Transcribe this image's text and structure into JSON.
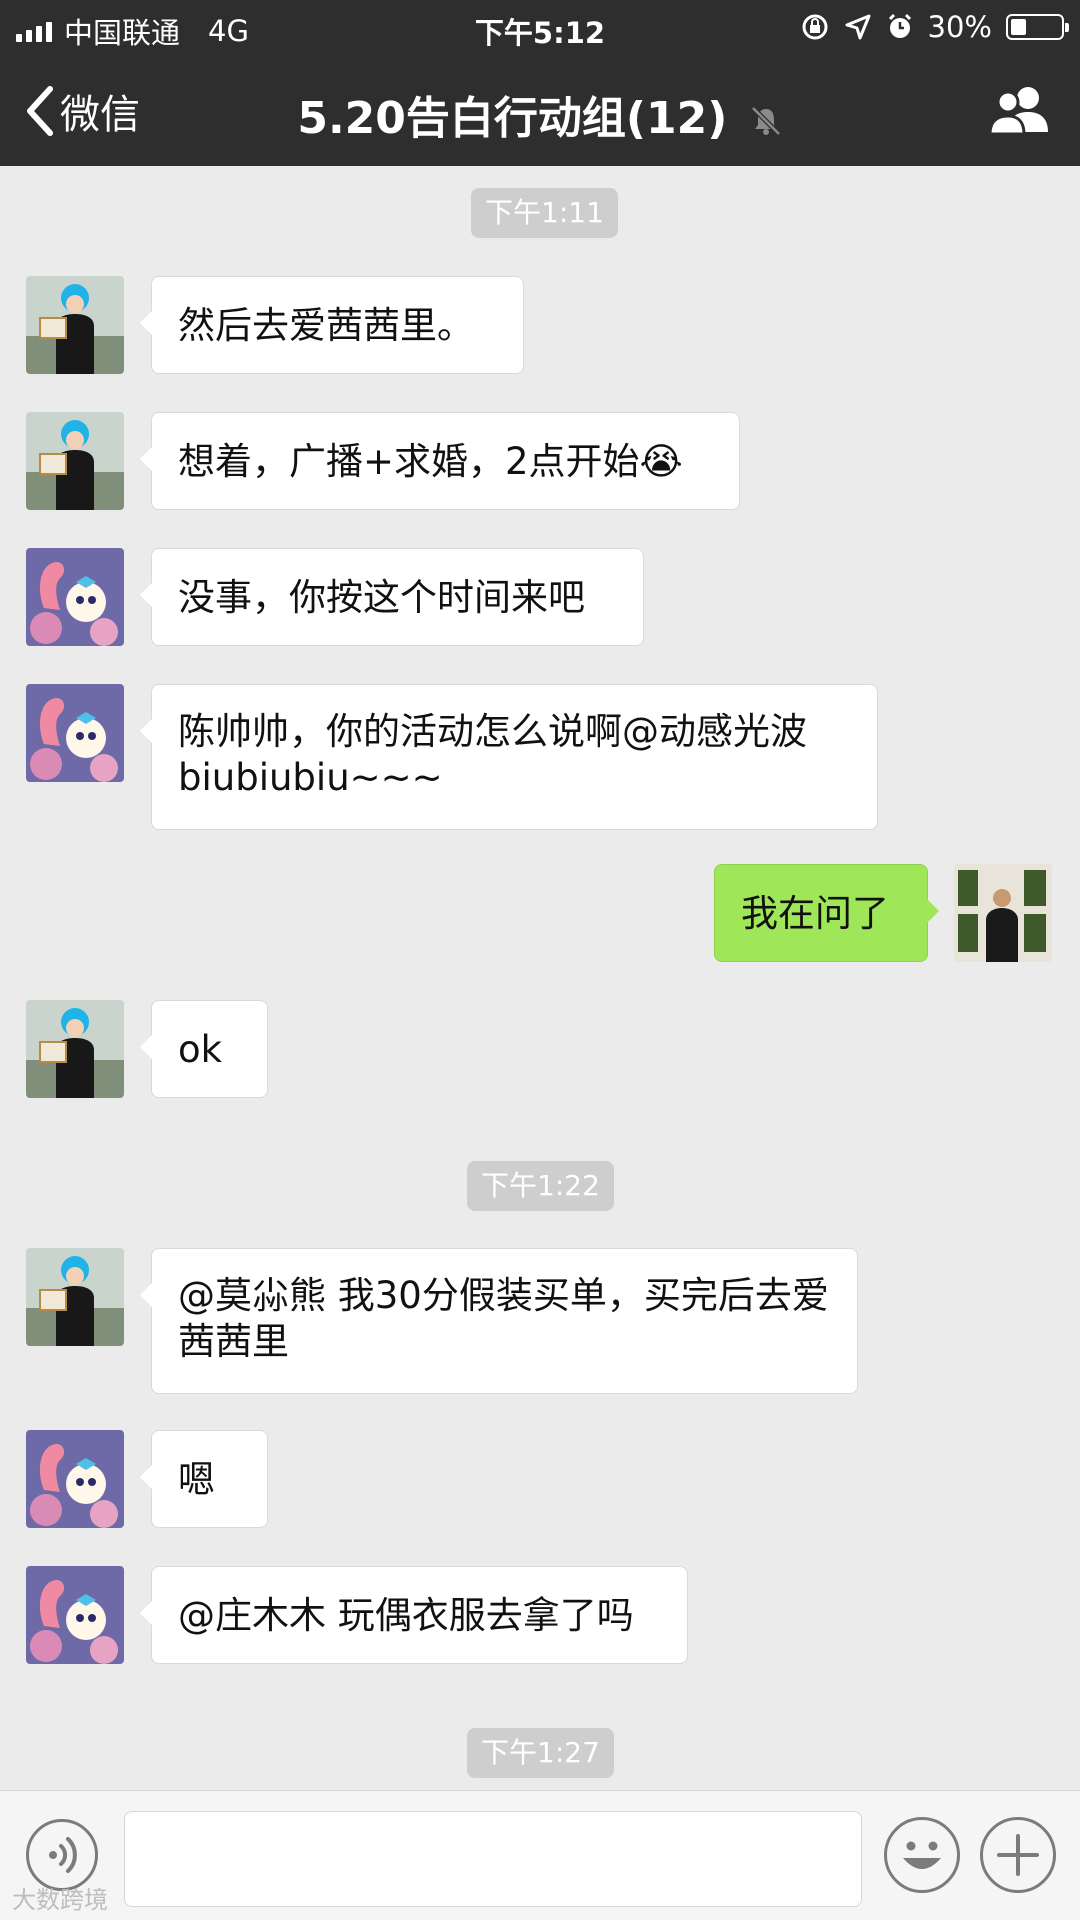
{
  "status_bar": {
    "carrier": "中国联通",
    "network": "4G",
    "time": "下午5:12",
    "battery_percent": "30%",
    "battery_level": 0.3
  },
  "nav": {
    "back_label": "微信",
    "title": "5.20告白行动组(12)"
  },
  "timestamps": [
    "下午1:11",
    "下午1:22",
    "下午1:27"
  ],
  "messages": [
    {
      "text": "然后去爱茜茜里。",
      "side": "left",
      "sender_avatar": "avatar-blue-hair"
    },
    {
      "text": "想着，广播+求婚，2点开始",
      "emoji": "😭",
      "side": "left",
      "sender_avatar": "avatar-blue-hair"
    },
    {
      "text": "没事，你按这个时间来吧",
      "side": "left",
      "sender_avatar": "avatar-flamingo-doll"
    },
    {
      "text": "陈帅帅，你的活动怎么说啊@动感光波biubiubiu~~~",
      "side": "left",
      "sender_avatar": "avatar-flamingo-doll"
    },
    {
      "text": "我在问了",
      "side": "right",
      "sender_avatar": "avatar-self"
    },
    {
      "text": "ok",
      "side": "left",
      "sender_avatar": "avatar-blue-hair"
    },
    {
      "text": "@莫尛熊 我30分假装买单，买完后去爱茜茜里",
      "side": "left",
      "sender_avatar": "avatar-blue-hair"
    },
    {
      "text": "嗯",
      "side": "left",
      "sender_avatar": "avatar-flamingo-doll"
    },
    {
      "text": "@庄木木 玩偶衣服去拿了吗",
      "side": "left",
      "sender_avatar": "avatar-flamingo-doll"
    }
  ],
  "watermark": "大数跨境",
  "colors": {
    "bar_bg": "#2e2e2e",
    "chat_bg": "#ebebeb",
    "bubble_self": "#9fe658",
    "bubble_other": "#ffffff"
  }
}
